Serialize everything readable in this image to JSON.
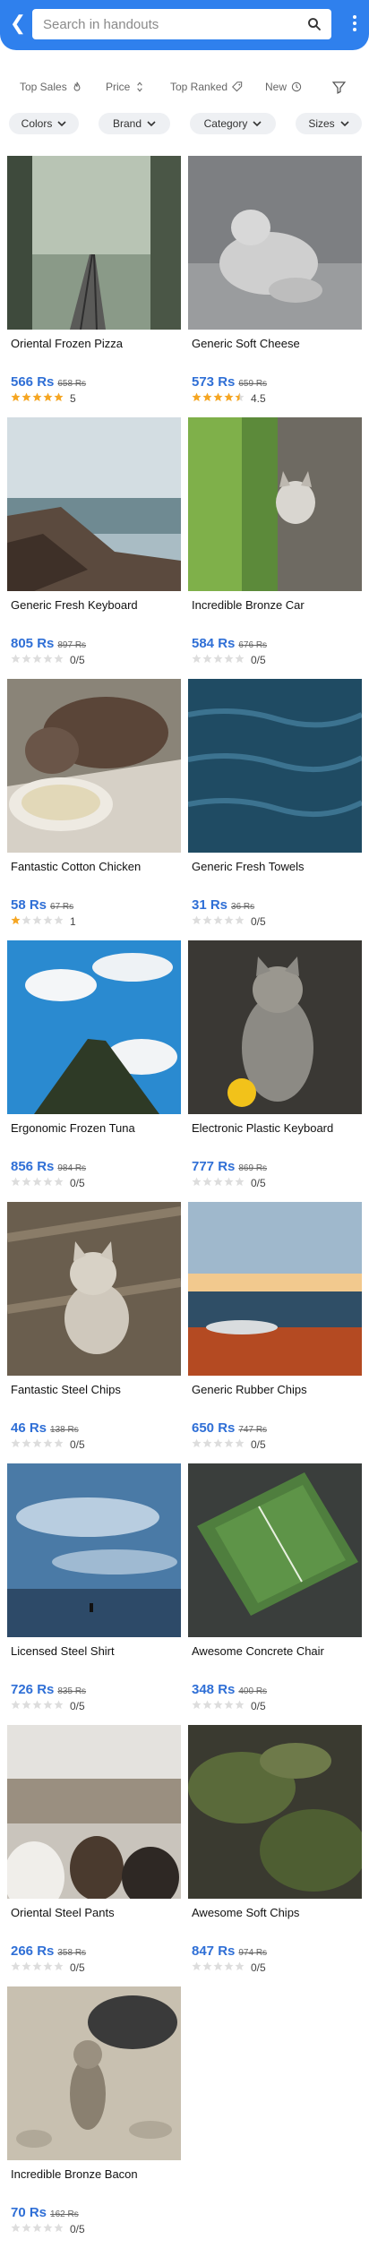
{
  "search": {
    "placeholder": "Search in handouts"
  },
  "sort": [
    {
      "label": "Top Sales",
      "icon": "flame-icon"
    },
    {
      "label": "Price",
      "icon": "sort-arrows-icon"
    },
    {
      "label": "Top Ranked",
      "icon": "tag-icon"
    },
    {
      "label": "New",
      "icon": "clock-icon"
    }
  ],
  "filters": [
    {
      "label": "Colors"
    },
    {
      "label": "Brand"
    },
    {
      "label": "Category"
    },
    {
      "label": "Sizes"
    }
  ],
  "colors": {
    "header": "#2f80ed",
    "price": "#2f6fd6",
    "star_filled": "#f5a623",
    "star_empty": "#dddddd"
  },
  "products": [
    {
      "title": "Oriental Frozen Pizza",
      "price": "566 Rs",
      "old_price": "658 Rs",
      "rating_text": "5",
      "rating_value": 5
    },
    {
      "title": "Generic Soft Cheese",
      "price": "573 Rs",
      "old_price": "659 Rs",
      "rating_text": "4.5",
      "rating_value": 4.5
    },
    {
      "title": "Generic Fresh Keyboard",
      "price": "805 Rs",
      "old_price": "897 Rs",
      "rating_text": "0/5",
      "rating_value": 0
    },
    {
      "title": "Incredible Bronze Car",
      "price": "584 Rs",
      "old_price": "676 Rs",
      "rating_text": "0/5",
      "rating_value": 0
    },
    {
      "title": "Fantastic Cotton Chicken",
      "price": "58 Rs",
      "old_price": "67 Rs",
      "rating_text": "1",
      "rating_value": 1
    },
    {
      "title": "Generic Fresh Towels",
      "price": "31 Rs",
      "old_price": "36 Rs",
      "rating_text": "0/5",
      "rating_value": 0
    },
    {
      "title": "Ergonomic Frozen Tuna",
      "price": "856 Rs",
      "old_price": "984 Rs",
      "rating_text": "0/5",
      "rating_value": 0
    },
    {
      "title": "Electronic Plastic Keyboard",
      "price": "777 Rs",
      "old_price": "869 Rs",
      "rating_text": "0/5",
      "rating_value": 0
    },
    {
      "title": "Fantastic Steel Chips",
      "price": "46 Rs",
      "old_price": "138 Rs",
      "rating_text": "0/5",
      "rating_value": 0
    },
    {
      "title": "Generic Rubber Chips",
      "price": "650 Rs",
      "old_price": "747 Rs",
      "rating_text": "0/5",
      "rating_value": 0
    },
    {
      "title": "Licensed Steel Shirt",
      "price": "726 Rs",
      "old_price": "835 Rs",
      "rating_text": "0/5",
      "rating_value": 0
    },
    {
      "title": "Awesome Concrete Chair",
      "price": "348 Rs",
      "old_price": "400 Rs",
      "rating_text": "0/5",
      "rating_value": 0
    },
    {
      "title": "Oriental Steel Pants",
      "price": "266 Rs",
      "old_price": "358 Rs",
      "rating_text": "0/5",
      "rating_value": 0
    },
    {
      "title": "Awesome Soft Chips",
      "price": "847 Rs",
      "old_price": "974 Rs",
      "rating_text": "0/5",
      "rating_value": 0
    },
    {
      "title": "Incredible Bronze Bacon",
      "price": "70 Rs",
      "old_price": "162 Rs",
      "rating_text": "0/5",
      "rating_value": 0
    }
  ]
}
